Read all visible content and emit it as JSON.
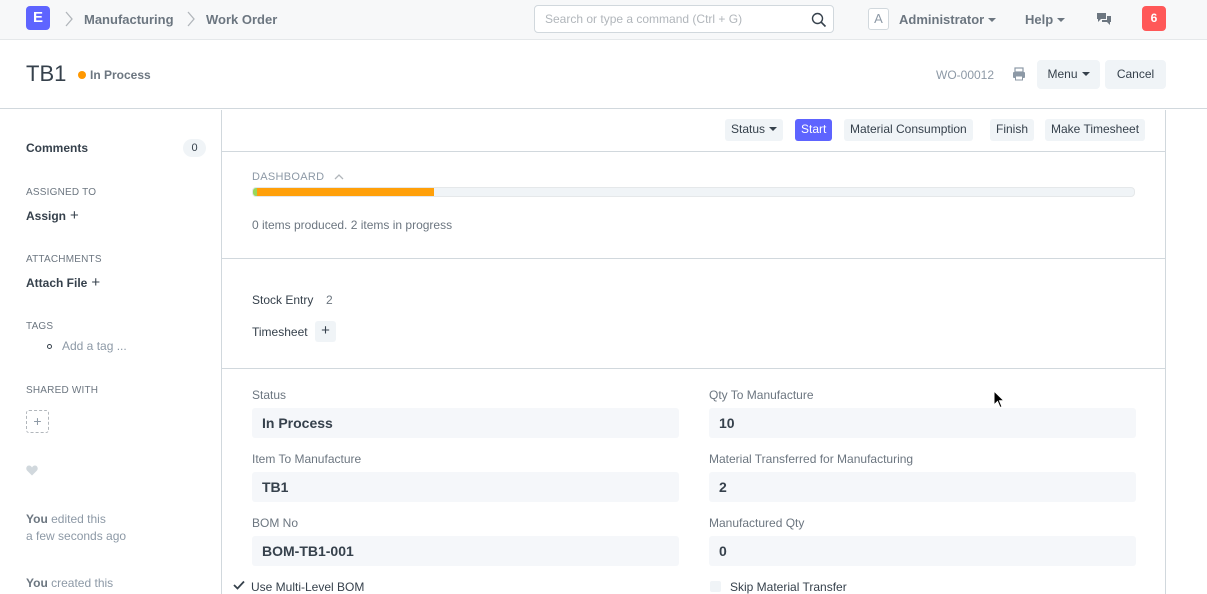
{
  "navbar": {
    "logo": "E",
    "breadcrumbs": [
      "Manufacturing",
      "Work Order"
    ],
    "search_placeholder": "Search or type a command (Ctrl + G)",
    "avatar_initial": "A",
    "user": "Administrator",
    "help": "Help",
    "notification_count": "6"
  },
  "page": {
    "title": "TB1",
    "status": "In Process",
    "status_color": "#ff9800",
    "docname": "WO-00012",
    "menu_label": "Menu",
    "cancel_label": "Cancel"
  },
  "sidebar": {
    "comments_label": "Comments",
    "comments_count": "0",
    "assigned_to_label": "ASSIGNED TO",
    "assign_action": "Assign",
    "attachments_label": "ATTACHMENTS",
    "attach_action": "Attach File",
    "tags_label": "TAGS",
    "tag_placeholder": "Add a tag ...",
    "shared_with_label": "SHARED WITH",
    "activity": [
      {
        "user": "You",
        "action": "edited this",
        "time": "a few seconds ago"
      },
      {
        "user": "You",
        "action": "created this"
      }
    ]
  },
  "toolbar": {
    "status": "Status",
    "start": "Start",
    "material_consumption": "Material Consumption",
    "finish": "Finish",
    "make_timesheet": "Make Timesheet",
    "accent_color": "#5e64ff"
  },
  "dashboard": {
    "label": "DASHBOARD",
    "produced_fraction": 0.003,
    "in_progress_fraction": 0.2,
    "message": "0 items produced. 2 items in progress"
  },
  "connections": {
    "stock_entry_label": "Stock Entry",
    "stock_entry_count": "2",
    "timesheet_label": "Timesheet"
  },
  "fields": {
    "status_label": "Status",
    "status_value": "In Process",
    "qty_label": "Qty To Manufacture",
    "qty_value": "10",
    "item_label": "Item To Manufacture",
    "item_value": "TB1",
    "transferred_label": "Material Transferred for Manufacturing",
    "transferred_value": "2",
    "bom_label": "BOM No",
    "bom_value": "BOM-TB1-001",
    "manufactured_label": "Manufactured Qty",
    "manufactured_value": "0",
    "multi_level_bom_label": "Use Multi-Level BOM",
    "multi_level_bom_checked": true,
    "skip_transfer_label": "Skip Material Transfer",
    "skip_transfer_checked": false
  }
}
